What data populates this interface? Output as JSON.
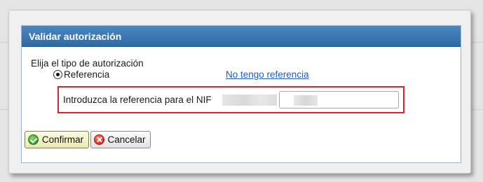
{
  "dialog": {
    "title": "Validar autorización"
  },
  "form": {
    "prompt": "Elija el tipo de autorización",
    "radio_option": "Referencia",
    "radio_selected": true,
    "no_reference_link": "No tengo referencia",
    "nif_label": "Introduzca la referencia para el NIF",
    "reference_value": ""
  },
  "buttons": {
    "confirm_label": "Confirmar",
    "cancel_label": "Cancelar"
  },
  "icons": {
    "confirm": "check-circle-icon",
    "cancel": "cancel-circle-icon"
  },
  "colors": {
    "header_blue": "#2e6ba6",
    "highlight_red": "#d9262b",
    "link_blue": "#1f5fb5"
  }
}
